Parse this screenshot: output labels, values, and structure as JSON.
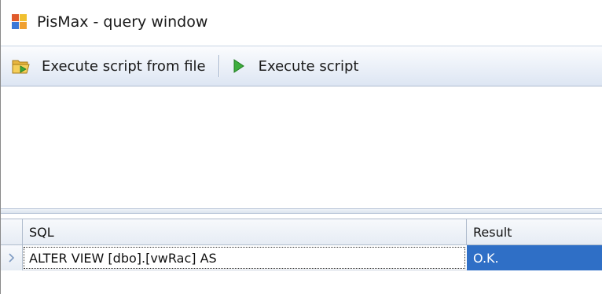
{
  "window": {
    "title": "PisMax - query window",
    "app_icon": "pismax-app-icon"
  },
  "toolbar": {
    "execute_file_label": "Execute script from file",
    "execute_file_icon": "folder-open-icon",
    "execute_label": "Execute script",
    "execute_icon": "play-icon"
  },
  "query_editor": {
    "text": ""
  },
  "results_grid": {
    "columns": [
      "SQL",
      "Result"
    ],
    "rows": [
      {
        "sql": "ALTER VIEW [dbo].[vwRac] AS",
        "result": "O.K."
      }
    ]
  },
  "colors": {
    "selected_cell": "#2f6fc6",
    "toolbar_gradient_top": "#fbfcfe",
    "toolbar_gradient_bottom": "#dde6f3"
  }
}
